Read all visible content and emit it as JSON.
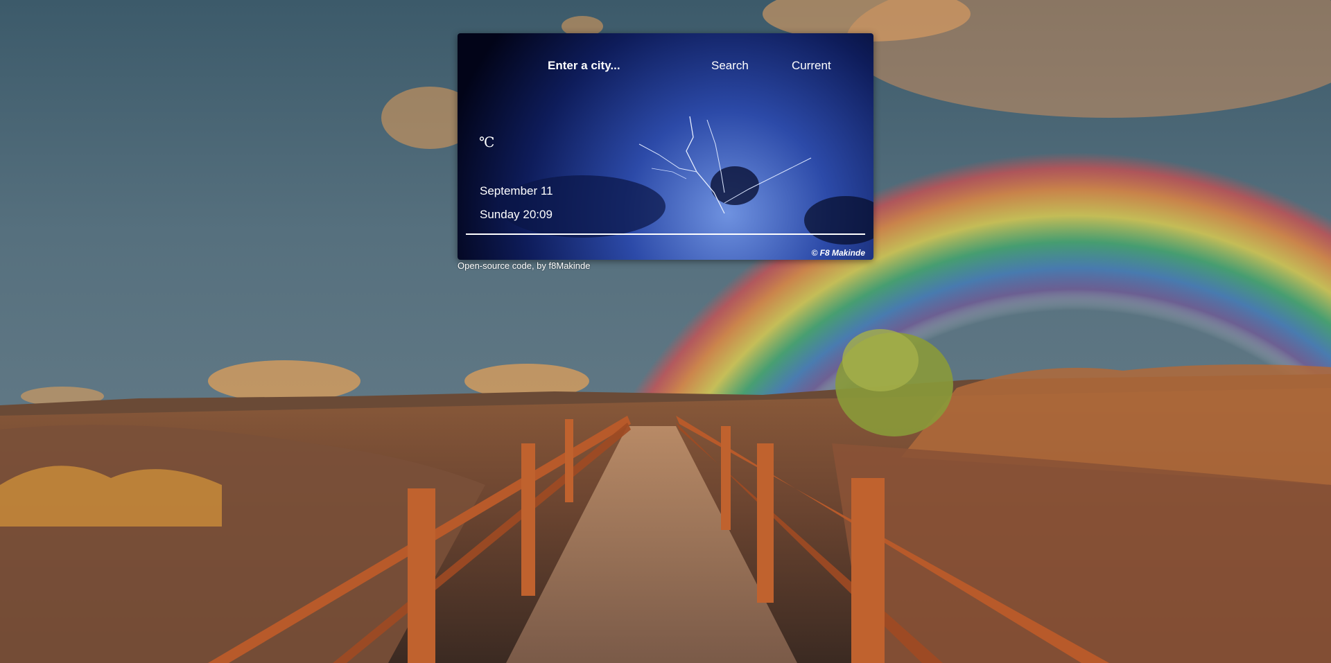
{
  "search": {
    "placeholder": "Enter a city...",
    "search_label": "Search",
    "current_label": "Current"
  },
  "weather": {
    "unit": "℃",
    "date": "September 11",
    "day_time": "Sunday 20:09"
  },
  "card_credit": "© F8 Makinde",
  "footer": {
    "note": "Open-source code, by f8Makinde"
  },
  "icons": {
    "background": "rainbow-landscape-image",
    "card_background": "lightning-storm-image"
  }
}
